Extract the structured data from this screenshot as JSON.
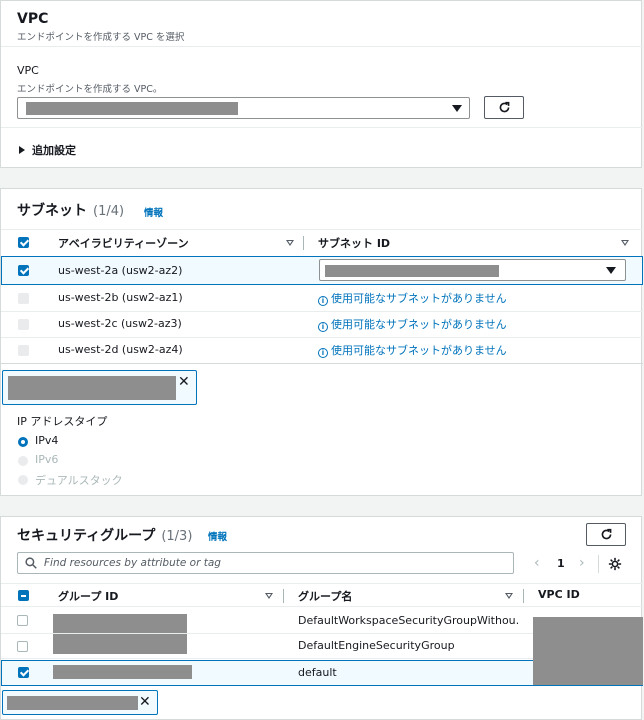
{
  "vpc": {
    "title": "VPC",
    "description": "エンドポイントを作成する VPC を選択",
    "field_label": "VPC",
    "field_description": "エンドポイントを作成する VPC。",
    "additional_settings": "追加設定"
  },
  "subnets": {
    "title": "サブネット",
    "count": "(1/4)",
    "info": "情報",
    "col_az": "アベイラビリティーゾーン",
    "col_subnet_id": "サブネット ID",
    "rows": [
      {
        "az": "us-west-2a (usw2-az2)",
        "checked": true
      },
      {
        "az": "us-west-2b (usw2-az1)",
        "checked": false,
        "message": "使用可能なサブネットがありません"
      },
      {
        "az": "us-west-2c (usw2-az3)",
        "checked": false,
        "message": "使用可能なサブネットがありません"
      },
      {
        "az": "us-west-2d (usw2-az4)",
        "checked": false,
        "message": "使用可能なサブネットがありません"
      }
    ]
  },
  "ip": {
    "label": "IP アドレスタイプ",
    "options": [
      "IPv4",
      "IPv6",
      "デュアルスタック"
    ],
    "selected": "IPv4"
  },
  "security_groups": {
    "title": "セキュリティグループ",
    "count": "(1/3)",
    "info": "情報",
    "search_placeholder": "Find resources by attribute or tag",
    "page": "1",
    "col_group_id": "グループ ID",
    "col_group_name": "グループ名",
    "col_vpc_id": "VPC ID",
    "rows": [
      {
        "name": "DefaultWorkspaceSecurityGroupWithou…",
        "checked": false
      },
      {
        "name": "DefaultEngineSecurityGroup",
        "checked": false
      },
      {
        "name": "default",
        "checked": true
      }
    ]
  },
  "colors": {
    "accent": "#0073bb",
    "redacted": "#8e8e8e",
    "border": "#d5dbdb"
  }
}
